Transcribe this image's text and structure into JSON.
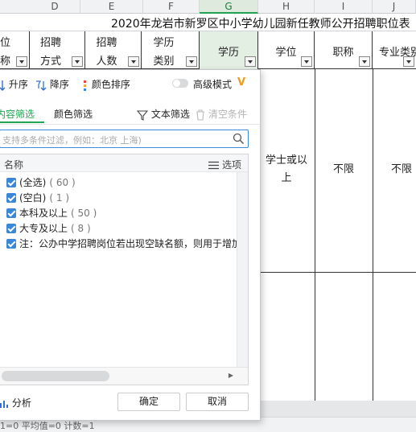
{
  "columns": [
    "D",
    "E",
    "F",
    "G",
    "H",
    "I",
    "J"
  ],
  "active_column": "G",
  "sheet_title": "2020年龙岩市新罗区中小学幼儿园新任教师公开招聘职位表",
  "headers": {
    "c_partial": {
      "l1": "位",
      "l2": "称"
    },
    "d": {
      "l1": "招聘",
      "l2": "方式"
    },
    "e": {
      "l1": "招聘",
      "l2": "人数"
    },
    "f": {
      "l1": "学历",
      "l2": "类别"
    },
    "g": "学历",
    "h": "学位",
    "i": "职称",
    "j": "专业类别"
  },
  "cells": {
    "degree": "学士或以上",
    "title_req": "不限",
    "major_req": "不限"
  },
  "popup": {
    "sort_asc": "升序",
    "sort_desc": "降序",
    "color_sort": "颜色排序",
    "advanced_mode": "高级模式",
    "tab_content": "内容筛选",
    "tab_color": "颜色筛选",
    "text_filter": "文本筛选",
    "clear_conditions": "清空条件",
    "search_placeholder": "支持多条件过滤，例如：北京  上海)",
    "list_header": "名称",
    "options_label": "选项",
    "items": [
      {
        "label": "(全选)",
        "count": "( 60 )",
        "checked": true
      },
      {
        "label": "(空白)",
        "count": "( 1 )",
        "checked": true
      },
      {
        "label": "本科及以上",
        "count": "( 50 )",
        "checked": true
      },
      {
        "label": "大专及以上",
        "count": "( 8 )",
        "checked": true
      },
      {
        "label": "注：公办中学招聘岗位若出现空缺名额，则用于增加小",
        "count": "",
        "checked": true
      }
    ],
    "analysis": "分析",
    "ok": "确定",
    "cancel": "取消"
  },
  "status": "1=0  平均值=0  计数=1",
  "colors": {
    "accent_green": "#23a553",
    "accent_blue": "#3a86d8",
    "vip_orange": "#f39b1b"
  }
}
